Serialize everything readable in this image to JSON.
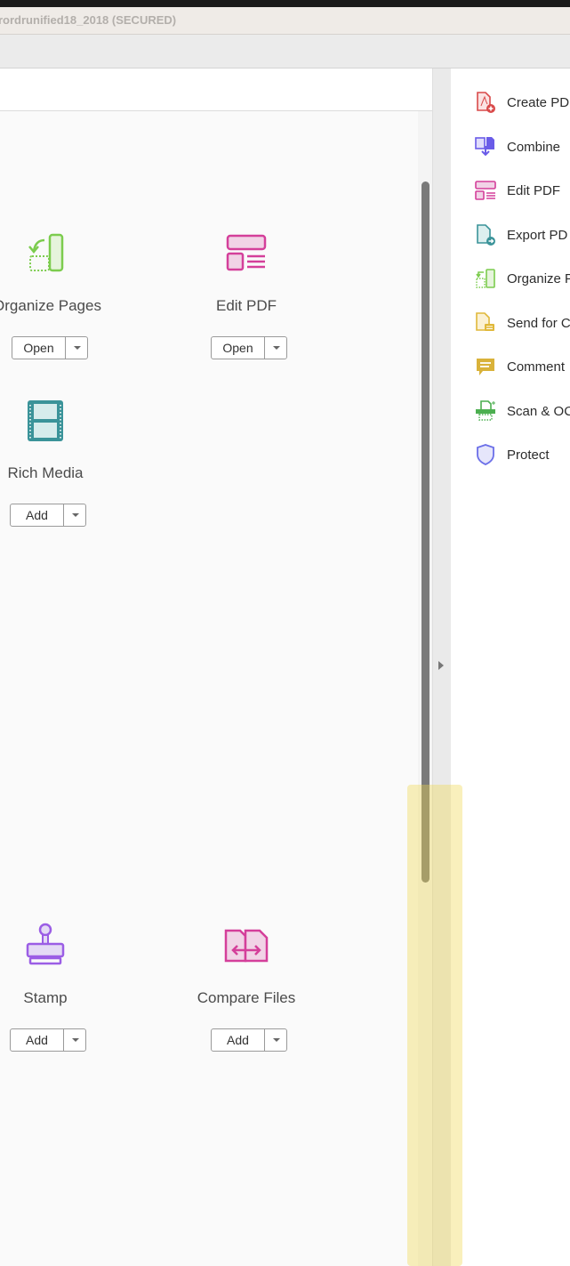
{
  "window": {
    "title": "rordrunified18_2018 (SECURED)"
  },
  "tools": [
    {
      "name": "Organize Pages",
      "button": "Open"
    },
    {
      "name": "Edit PDF",
      "button": "Open"
    },
    {
      "name": "Rich Media",
      "button": "Add"
    },
    {
      "name": "Stamp",
      "button": "Add"
    },
    {
      "name": "Compare Files",
      "button": "Add"
    }
  ],
  "right_panel": {
    "items": [
      {
        "label": "Create PD",
        "icon": "create-pdf-icon",
        "color": "#d94a4a"
      },
      {
        "label": "Combine",
        "icon": "combine-files-icon",
        "color": "#6a5ce8"
      },
      {
        "label": "Edit PDF",
        "icon": "edit-pdf-icon",
        "color": "#d43f9a"
      },
      {
        "label": "Export PD",
        "icon": "export-pdf-icon",
        "color": "#3a9399"
      },
      {
        "label": "Organize P",
        "icon": "organize-pages-icon",
        "color": "#7ccc4e"
      },
      {
        "label": "Send for C",
        "icon": "send-for-comments-icon",
        "color": "#e0b83a"
      },
      {
        "label": "Comment",
        "icon": "comment-icon",
        "color": "#d9b23a"
      },
      {
        "label": "Scan & OC",
        "icon": "scan-ocr-icon",
        "color": "#4caf50"
      },
      {
        "label": "Protect",
        "icon": "protect-shield-icon",
        "color": "#6b6fe8"
      }
    ]
  }
}
